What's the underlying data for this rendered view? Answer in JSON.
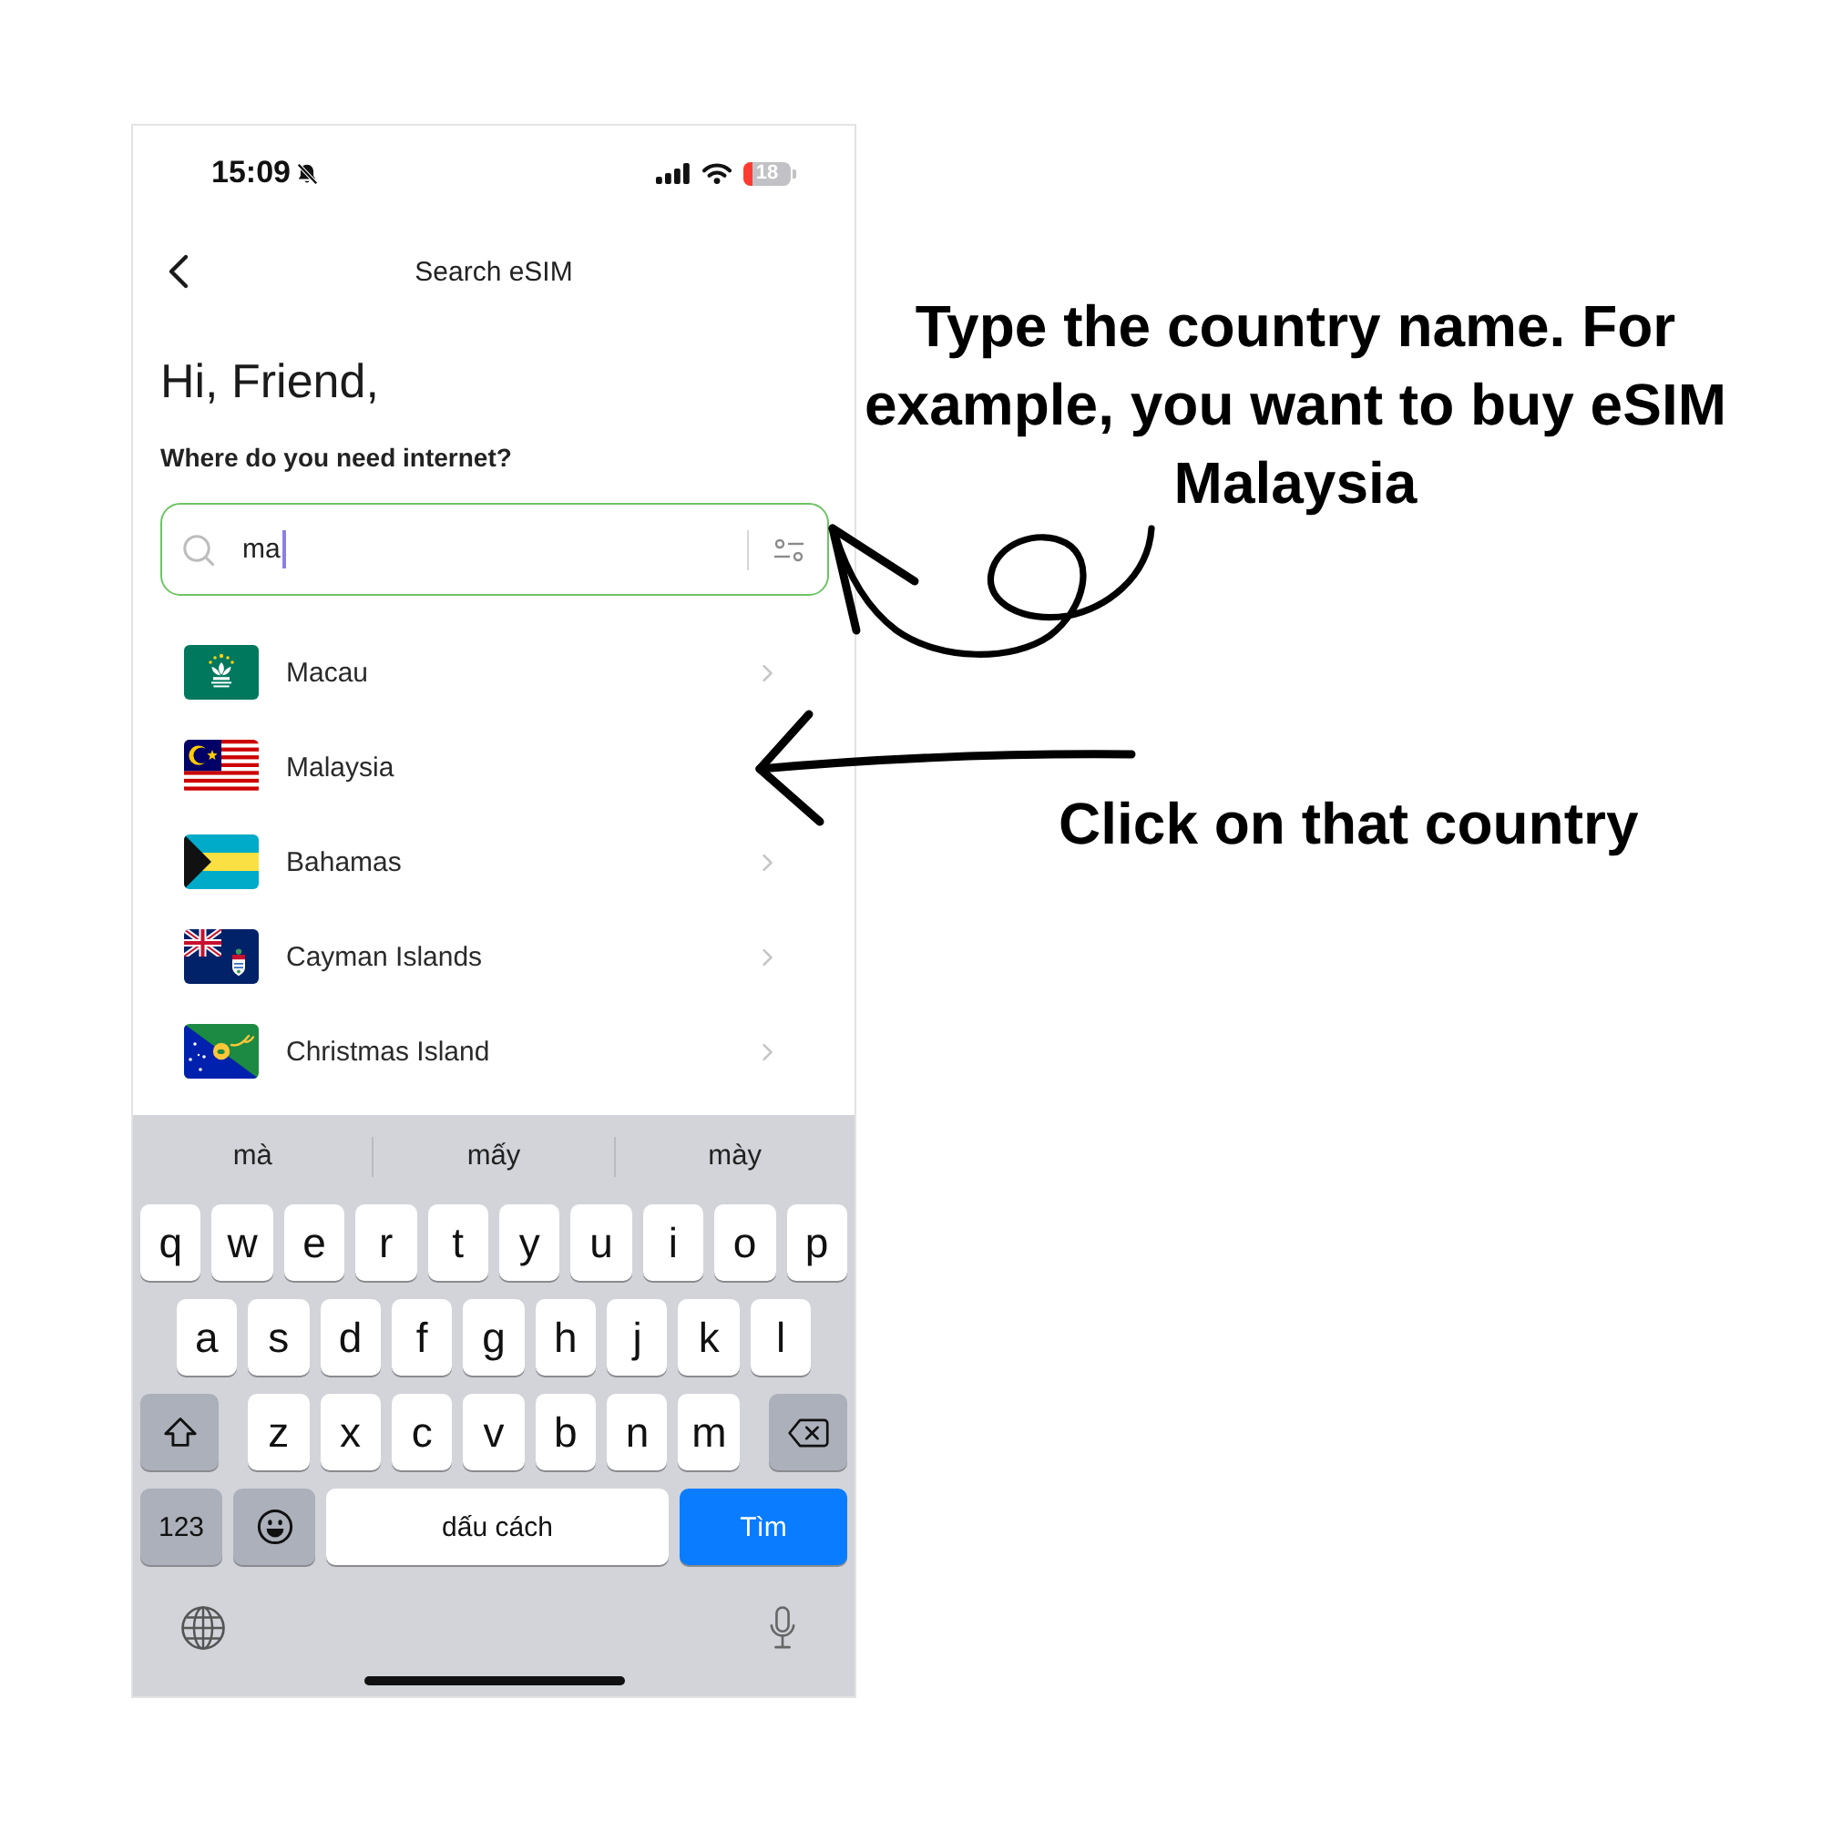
{
  "status_bar": {
    "time": "15:09",
    "silent": true,
    "battery": "18"
  },
  "header": {
    "title": "Search eSIM"
  },
  "greeting": "Hi, Friend,",
  "prompt": "Where do you need internet?",
  "search": {
    "value": "ma"
  },
  "results": [
    {
      "name": "Macau"
    },
    {
      "name": "Malaysia"
    },
    {
      "name": "Bahamas"
    },
    {
      "name": "Cayman Islands"
    },
    {
      "name": "Christmas Island"
    }
  ],
  "keyboard": {
    "suggestions": [
      "mà",
      "mấy",
      "mày"
    ],
    "letter_rows": [
      [
        "q",
        "w",
        "e",
        "r",
        "t",
        "y",
        "u",
        "i",
        "o",
        "p"
      ],
      [
        "a",
        "s",
        "d",
        "f",
        "g",
        "h",
        "j",
        "k",
        "l"
      ],
      [
        "z",
        "x",
        "c",
        "v",
        "b",
        "n",
        "m"
      ]
    ],
    "bottom_keys": [
      {
        "kind": "numbers",
        "label": "123"
      },
      {
        "kind": "emoji"
      },
      {
        "kind": "space",
        "label": "dấu cách"
      },
      {
        "kind": "search",
        "label": "Tìm"
      }
    ]
  },
  "callouts": {
    "search_tip": "Type the country name. For example, you want to buy eSIM Malaysia",
    "country_tip": "Click on that country"
  }
}
